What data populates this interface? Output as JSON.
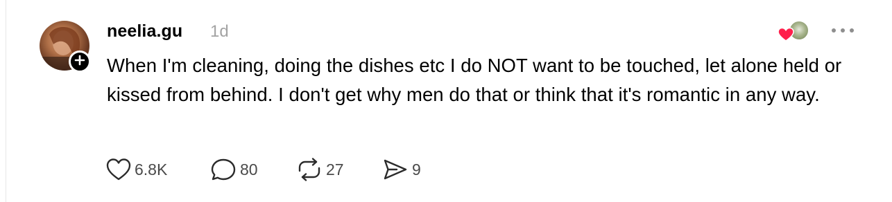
{
  "post": {
    "username": "neelia.gu",
    "timestamp": "1d",
    "text": "When I'm cleaning, doing the dishes etc I do NOT want to be touched, let alone held or kissed from behind. I don't get why men do that or think that it's romantic in any way."
  },
  "icons": {
    "follow": "plus-icon",
    "more": "more-icon",
    "like": "heart-outline-icon",
    "reply": "comment-bubble-icon",
    "repost": "repost-icon",
    "share": "send-icon",
    "reaction": "heart-filled-icon"
  },
  "actions": {
    "likes": "6.8K",
    "replies": "80",
    "reposts": "27",
    "shares": "9"
  },
  "colors": {
    "timestamp": "#a3a3a3",
    "reaction_heart": "#ff1f4b",
    "count_text": "#4a4a4a"
  }
}
